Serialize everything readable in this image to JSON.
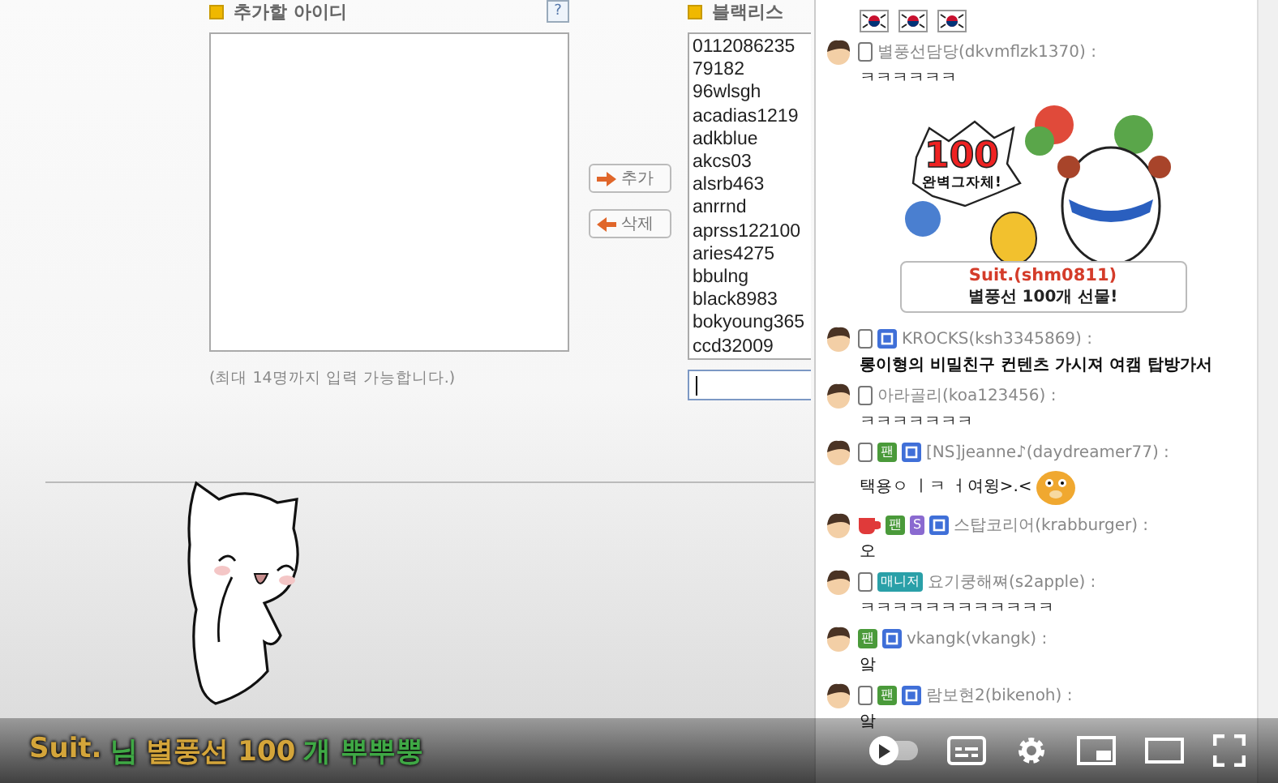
{
  "add_panel": {
    "title": "추가할 아이디",
    "help": "?",
    "note": "(최대 14명까지 입력 가능합니다.)"
  },
  "buttons": [
    {
      "kind": "add",
      "label": "추가"
    },
    {
      "kind": "delete",
      "label": "삭제"
    }
  ],
  "blacklist": {
    "title": "블랙리스",
    "items": [
      "0112086235",
      "79182",
      "96wlsgh",
      "acadias1219",
      "adkblue",
      "akcs03",
      "alsrb463",
      "anrrnd",
      "aprss122100",
      "aries4275",
      "bbulng",
      "black8983",
      "bokyoung365",
      "ccd32009"
    ]
  },
  "caption": [
    {
      "text": "Suit.",
      "color": "#d4a53a"
    },
    {
      "text": "님",
      "color": "#3fa845"
    },
    {
      "text": "별풍선 100",
      "color": "#d4a53a"
    },
    {
      "text": "개 뿌뿌뿡",
      "color": "#3fa845"
    }
  ],
  "chat": [
    {
      "kind": "emotes",
      "items": [
        {
          "kind": "flag"
        },
        {
          "kind": "flag"
        },
        {
          "kind": "flag"
        }
      ]
    },
    {
      "kind": "chat",
      "badges": [
        {
          "kind": "phone"
        }
      ],
      "name": "별풍선담당(dkvmflzk1370) :",
      "text": "ㅋㅋㅋㅋㅋㅋ",
      "bold": false,
      "emoticon": false
    },
    {
      "kind": "gift",
      "number": "100",
      "slogan": "완벽그자체!",
      "sender": "Suit.(shm0811)",
      "message": "별풍선 100개 선물!"
    },
    {
      "kind": "chat",
      "badges": [
        {
          "kind": "phone"
        },
        {
          "kind": "blue"
        }
      ],
      "name": "KROCKS(ksh3345869) :",
      "text": "롱이형의 비밀친구 컨텐츠 가시져 여캠 탑방가서",
      "bold": true,
      "emoticon": false
    },
    {
      "kind": "chat",
      "badges": [
        {
          "kind": "phone"
        }
      ],
      "name": "아라골리(koa123456) :",
      "text": "ㅋㅋㅋㅋㅋㅋㅋ",
      "bold": false,
      "emoticon": false
    },
    {
      "kind": "chat",
      "badges": [
        {
          "kind": "phone"
        },
        {
          "kind": "fan",
          "label": "팬"
        },
        {
          "kind": "blue"
        }
      ],
      "name": "[NS]jeanne♪(daydreamer77) :",
      "text": "택용ㅇ ㅣㅋ ㅓ여윙>.<",
      "bold": false,
      "emoticon": true
    },
    {
      "kind": "chat",
      "badges": [
        {
          "kind": "cup"
        },
        {
          "kind": "fan",
          "label": "팬"
        },
        {
          "kind": "support",
          "label": "S"
        },
        {
          "kind": "blue"
        }
      ],
      "name": "스탑코리어(krabburger) :",
      "text": "오",
      "bold": false,
      "emoticon": false
    },
    {
      "kind": "chat",
      "badges": [
        {
          "kind": "phone"
        },
        {
          "kind": "manager",
          "label": "매니저"
        }
      ],
      "name": "요기쿵해쪄(s2apple) :",
      "text": "ㅋㅋㅋㅋㅋㅋㅋㅋㅋㅋㅋㅋ",
      "bold": false,
      "emoticon": false
    },
    {
      "kind": "chat",
      "badges": [
        {
          "kind": "fan",
          "label": "팬"
        },
        {
          "kind": "blue"
        }
      ],
      "name": "vkangk(vkangk) :",
      "text": "앜",
      "bold": false,
      "emoticon": false
    },
    {
      "kind": "chat",
      "badges": [
        {
          "kind": "phone"
        },
        {
          "kind": "fan",
          "label": "팬"
        },
        {
          "kind": "blue"
        }
      ],
      "name": "람보현2(bikenoh) :",
      "text": "앜",
      "bold": false,
      "emoticon": false
    }
  ],
  "player": {
    "autoplay_on": false
  }
}
